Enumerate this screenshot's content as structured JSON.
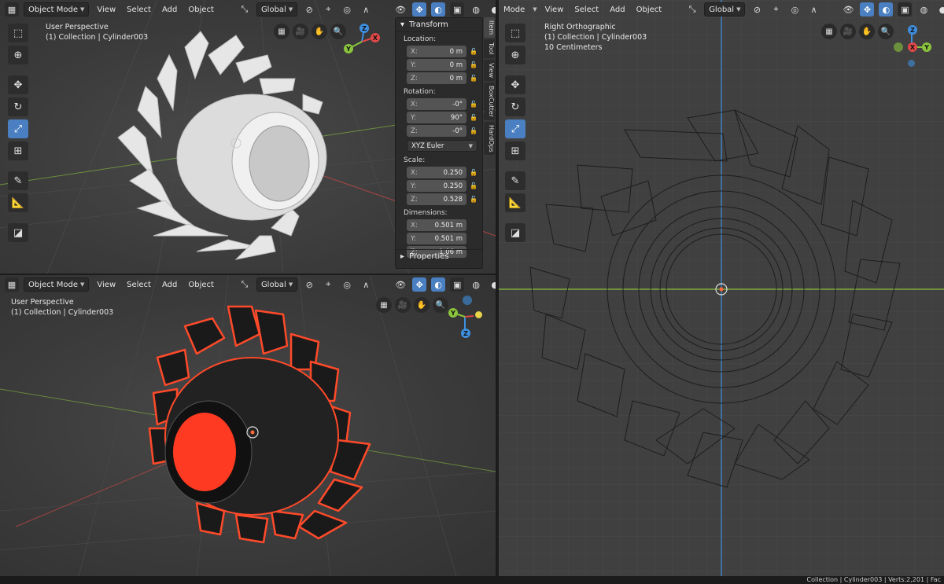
{
  "top_left": {
    "header": {
      "mode": "Object Mode",
      "menus": [
        "View",
        "Select",
        "Add",
        "Object"
      ],
      "orientation": "Global"
    },
    "info": [
      "User Perspective",
      "(1) Collection | Cylinder003"
    ]
  },
  "bottom_left": {
    "header": {
      "mode": "Object Mode",
      "menus": [
        "View",
        "Select",
        "Add",
        "Object"
      ],
      "orientation": "Global"
    },
    "info": [
      "User Perspective",
      "(1) Collection | Cylinder003"
    ]
  },
  "right": {
    "header": {
      "mode": "Mode",
      "menus": [
        "View",
        "Select",
        "Add",
        "Object"
      ],
      "orientation": "Global"
    },
    "info": [
      "Right Orthographic",
      "(1) Collection | Cylinder003",
      "10 Centimeters"
    ]
  },
  "gizmo_labels": {
    "x": "X",
    "y": "Y",
    "z": "Z"
  },
  "npanel": {
    "title": "Transform",
    "location": {
      "label": "Location:",
      "x": "0 m",
      "y": "0 m",
      "z": "0 m"
    },
    "rotation": {
      "label": "Rotation:",
      "x": "-0°",
      "y": "90°",
      "z": "-0°"
    },
    "rotation_mode": "XYZ Euler",
    "scale": {
      "label": "Scale:",
      "x": "0.250",
      "y": "0.250",
      "z": "0.528"
    },
    "dimensions": {
      "label": "Dimensions:",
      "x": "0.501 m",
      "y": "0.501 m",
      "z": "1.06 m"
    },
    "axis_labels": {
      "x": "X:",
      "y": "Y:",
      "z": "Z:"
    },
    "properties": "Properties",
    "tabs": [
      "Item",
      "Tool",
      "View",
      "BoxCutter",
      "HardOps"
    ]
  },
  "status": "Collection | Cylinder003 | Verts:2,201 | Fac",
  "colors": {
    "accent": "#4a7fc1",
    "outline": "#ff4a2a",
    "x_axis": "#e04848",
    "y_axis": "#8ac43c",
    "z_axis": "#3f8fe0"
  }
}
